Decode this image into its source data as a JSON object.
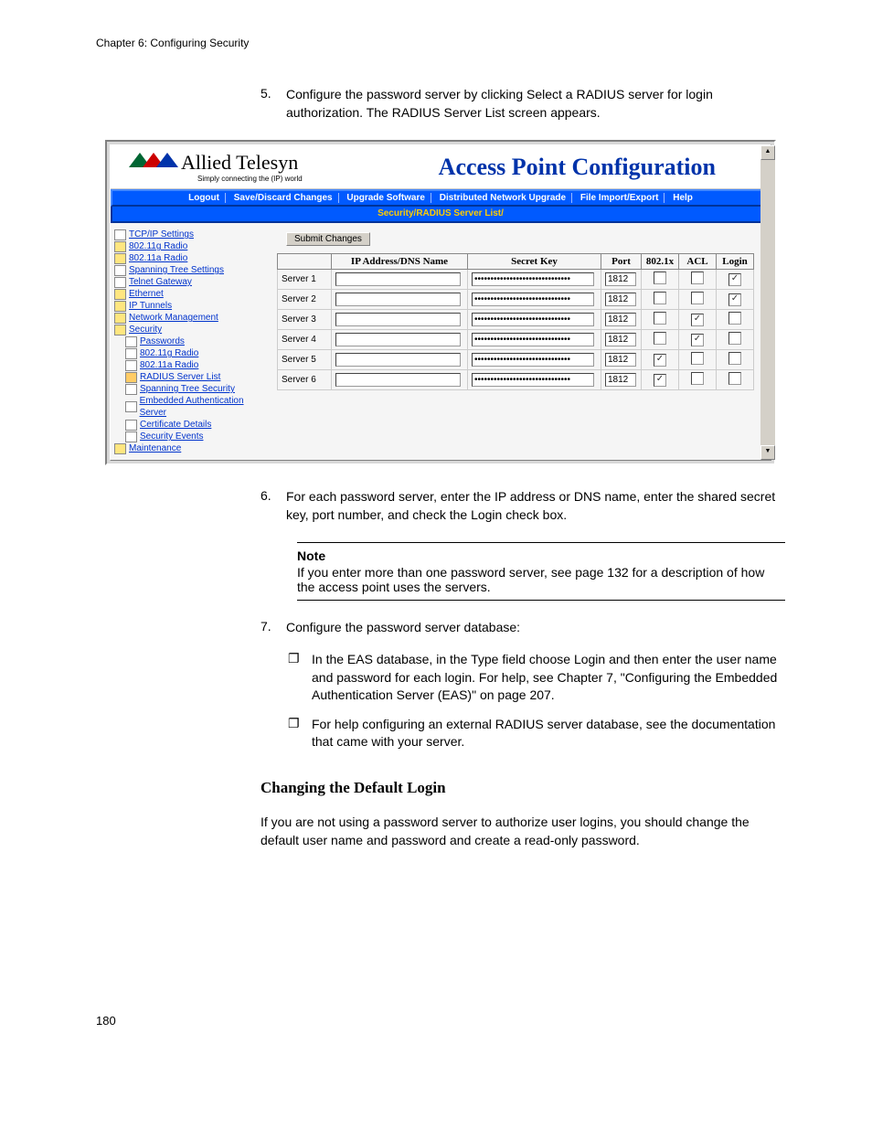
{
  "chapter_header": "Chapter 6: Configuring Security",
  "step5": {
    "num": "5.",
    "text": "Configure the password server by clicking Select a RADIUS server for login authorization. The RADIUS Server List screen appears."
  },
  "step6": {
    "num": "6.",
    "text": "For each password server, enter the IP address or DNS name, enter the shared secret key, port number, and check the Login check box."
  },
  "step7": {
    "num": "7.",
    "text": "Configure the password server database:"
  },
  "bullets": [
    "In the EAS database, in the Type field choose Login and then enter the user name and password for each login. For help, see Chapter 7, \"Configuring the Embedded Authentication Server (EAS)\" on page 207.",
    "For help configuring an external RADIUS server database, see the documentation that came with your server."
  ],
  "note": {
    "title": "Note",
    "body": "If you enter more than one password server, see page 132 for a description of how the access point uses the servers."
  },
  "section_heading": "Changing the Default Login",
  "paragraph": "If you are not using a password server to authorize user logins, you should change the default user name and password and create a read-only password.",
  "page_number": "180",
  "screenshot": {
    "logo_text": "Allied Telesyn",
    "logo_tagline": "Simply connecting the (IP) world",
    "banner_title": "Access Point Configuration",
    "menu": [
      "Logout",
      "Save/Discard Changes",
      "Upgrade Software",
      "Distributed Network Upgrade",
      "File Import/Export",
      "Help"
    ],
    "breadcrumb": "Security/RADIUS Server List/",
    "submit_label": "Submit Changes",
    "sidebar": [
      {
        "label": "TCP/IP Settings",
        "icon": "page",
        "indent": 0
      },
      {
        "label": "802.11g Radio",
        "icon": "folder",
        "indent": 0
      },
      {
        "label": "802.11a Radio",
        "icon": "folder",
        "indent": 0
      },
      {
        "label": "Spanning Tree Settings",
        "icon": "page",
        "indent": 0
      },
      {
        "label": "Telnet Gateway",
        "icon": "page",
        "indent": 0
      },
      {
        "label": "Ethernet",
        "icon": "folder",
        "indent": 0
      },
      {
        "label": "IP Tunnels",
        "icon": "folder",
        "indent": 0
      },
      {
        "label": "Network Management",
        "icon": "folder",
        "indent": 0
      },
      {
        "label": "Security",
        "icon": "folder-open",
        "indent": 0
      },
      {
        "label": "Passwords",
        "icon": "page",
        "indent": 1
      },
      {
        "label": "802.11g Radio",
        "icon": "page",
        "indent": 1
      },
      {
        "label": "802.11a Radio",
        "icon": "page",
        "indent": 1
      },
      {
        "label": "RADIUS Server List",
        "icon": "page-sel",
        "indent": 1
      },
      {
        "label": "Spanning Tree Security",
        "icon": "page",
        "indent": 1
      },
      {
        "label": "Embedded Authentication Server",
        "icon": "page",
        "indent": 1
      },
      {
        "label": "Certificate Details",
        "icon": "page",
        "indent": 1
      },
      {
        "label": "Security Events",
        "icon": "page",
        "indent": 1
      },
      {
        "label": "Maintenance",
        "icon": "folder",
        "indent": 0
      }
    ],
    "table": {
      "headers": [
        "",
        "IP Address/DNS Name",
        "Secret Key",
        "Port",
        "802.1x",
        "ACL",
        "Login"
      ],
      "rows": [
        {
          "label": "Server 1",
          "ip": "",
          "secret": "••••••••••••••••••••••••••••••",
          "port": "1812",
          "x": false,
          "acl": false,
          "login": true
        },
        {
          "label": "Server 2",
          "ip": "",
          "secret": "••••••••••••••••••••••••••••••",
          "port": "1812",
          "x": false,
          "acl": false,
          "login": true
        },
        {
          "label": "Server 3",
          "ip": "",
          "secret": "••••••••••••••••••••••••••••••",
          "port": "1812",
          "x": false,
          "acl": true,
          "login": false
        },
        {
          "label": "Server 4",
          "ip": "",
          "secret": "••••••••••••••••••••••••••••••",
          "port": "1812",
          "x": false,
          "acl": true,
          "login": false
        },
        {
          "label": "Server 5",
          "ip": "",
          "secret": "••••••••••••••••••••••••••••••",
          "port": "1812",
          "x": true,
          "acl": false,
          "login": false
        },
        {
          "label": "Server 6",
          "ip": "",
          "secret": "••••••••••••••••••••••••••••••",
          "port": "1812",
          "x": true,
          "acl": false,
          "login": false
        }
      ]
    }
  }
}
